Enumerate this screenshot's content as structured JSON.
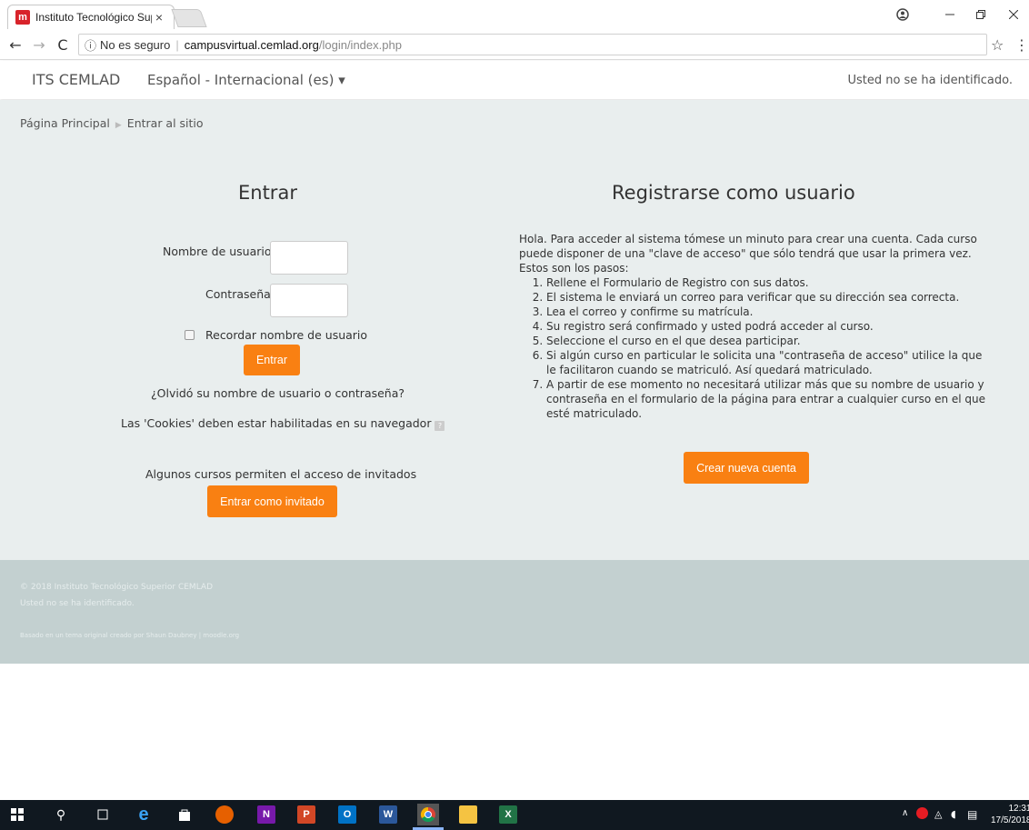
{
  "browser": {
    "tab_title": "Instituto Tecnológico Sup",
    "tab_close": "×",
    "security": "No es seguro",
    "url_host": "campusvirtual.cemlad.org",
    "url_path": "/login/index.php"
  },
  "navbar": {
    "brand": "ITS CEMLAD",
    "language": "Español - Internacional (es) ▾",
    "login_info": "Usted no se ha identificado."
  },
  "breadcrumb": {
    "home": "Página Principal",
    "current": "Entrar al sitio"
  },
  "login": {
    "heading": "Entrar",
    "username_label": "Nombre de usuario",
    "username_value": "",
    "password_label": "Contraseña",
    "password_value": "",
    "remember_label": "Recordar nombre de usuario",
    "remember_checked": false,
    "submit_label": "Entrar",
    "forgot_link": "¿Olvidó su nombre de usuario o contraseña?",
    "cookies_notice": "Las 'Cookies' deben estar habilitadas en su navegador",
    "guest_notice": "Algunos cursos permiten el acceso de invitados",
    "guest_button": "Entrar como invitado"
  },
  "signup": {
    "heading": "Registrarse como usuario",
    "intro": "Hola. Para acceder al sistema tómese un minuto para crear una cuenta. Cada curso puede disponer de una \"clave de acceso\" que sólo tendrá que usar la primera vez. Estos son los pasos:",
    "steps": [
      "Rellene el Formulario de Registro con sus datos.",
      "El sistema le enviará un correo para verificar que su dirección sea correcta.",
      "Lea el correo y confirme su matrícula.",
      "Su registro será confirmado y usted podrá acceder al curso.",
      "Seleccione el curso en el que desea participar.",
      "Si algún curso en particular le solicita una \"contraseña de acceso\" utilice la que le facilitaron cuando se matriculó. Así quedará matriculado.",
      "A partir de ese momento no necesitará utilizar más que su nombre de usuario y contraseña en el formulario de la página para entrar a cualquier curso en el que esté matriculado."
    ],
    "button": "Crear nueva cuenta"
  },
  "footer": {
    "copyright": "© 2018 Instituto Tecnológico Superior CEMLAD",
    "login_info": "Usted no se ha identificado.",
    "credits": "Basado en un tema original creado por Shaun Daubney | moodle.org"
  },
  "taskbar": {
    "time": "12:31",
    "date": "17/5/2018"
  },
  "colors": {
    "accent": "#f98012",
    "page_bg": "#e9eeee",
    "footer_bg": "#c3d0d0"
  }
}
